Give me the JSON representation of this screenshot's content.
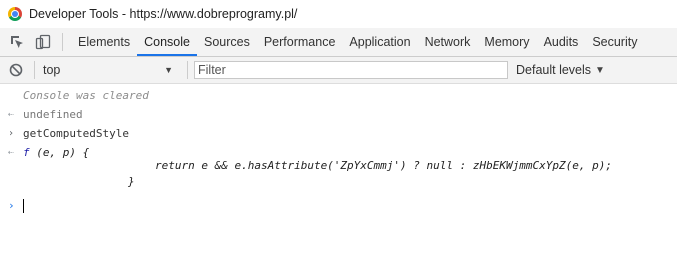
{
  "window": {
    "title": "Developer Tools - https://www.dobreprogramy.pl/"
  },
  "toolbar": {
    "tabs": [
      {
        "label": "Elements"
      },
      {
        "label": "Console"
      },
      {
        "label": "Sources"
      },
      {
        "label": "Performance"
      },
      {
        "label": "Application"
      },
      {
        "label": "Network"
      },
      {
        "label": "Memory"
      },
      {
        "label": "Audits"
      },
      {
        "label": "Security"
      }
    ],
    "active_tab": "Console"
  },
  "filterbar": {
    "context": "top",
    "filter_placeholder": "Filter",
    "levels": "Default levels"
  },
  "console": {
    "cleared": "Console was cleared",
    "result_undefined": "undefined",
    "input_command": "getComputedStyle",
    "fn_keyword": "f",
    "fn_signature": "(e, p) {",
    "fn_body": "return e && e.hasAttribute('ZpYxCmmj') ? null : zHbEKWjmmCxYpZ(e, p);",
    "fn_close": "}"
  },
  "colors": {
    "accent": "#1a73e8",
    "toolbar_bg": "#f3f3f3"
  }
}
